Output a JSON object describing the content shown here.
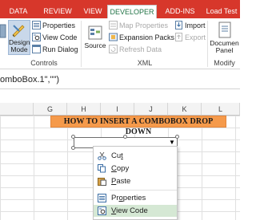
{
  "ribbon_tabs": [
    {
      "label": "DATA"
    },
    {
      "label": "REVIEW"
    },
    {
      "label": "VIEW"
    },
    {
      "label": "DEVELOPER",
      "active": true
    },
    {
      "label": "ADD-INS"
    },
    {
      "label": "Load Test"
    }
  ],
  "controls_group": {
    "label": "Controls",
    "design_mode": {
      "line1": "Design",
      "line2": "Mode"
    },
    "properties": "Properties",
    "view_code": "View Code",
    "run_dialog": "Run Dialog"
  },
  "xml_group": {
    "label": "XML",
    "source": "Source",
    "map_properties": "Map Properties",
    "expansion_packs": "Expansion Packs",
    "refresh_data": "Refresh Data",
    "import": "Import",
    "export": "Export"
  },
  "modify_group": {
    "label": "Modify",
    "document_panel": {
      "line1": "Documen",
      "line2": "Panel"
    }
  },
  "formula_bar": {
    "text": "omboBox.1\",\"\")"
  },
  "column_headers": [
    "G",
    "H",
    "I",
    "J",
    "K",
    "L"
  ],
  "banner": {
    "text": "HOW TO INSERT A COMBOBOX DROP DOWN"
  },
  "context_menu": {
    "cut": {
      "before": "Cu",
      "key": "t",
      "after": ""
    },
    "copy": {
      "before": "",
      "key": "C",
      "after": "opy"
    },
    "paste": {
      "before": "",
      "key": "P",
      "after": "aste"
    },
    "properties": {
      "before": "Pr",
      "key": "o",
      "after": "perties"
    },
    "view_code": {
      "before": "",
      "key": "V",
      "after": "iew Code"
    }
  },
  "colors": {
    "accent": "#d7372b",
    "excel_green": "#217346",
    "banner": "#f59a4b",
    "hover": "#d5e8d4"
  }
}
